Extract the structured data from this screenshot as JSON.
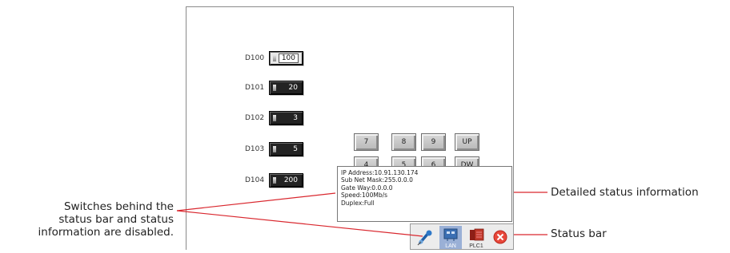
{
  "registers": [
    {
      "label": "D100",
      "value": "100",
      "focused": true
    },
    {
      "label": "D101",
      "value": "20",
      "focused": false
    },
    {
      "label": "D102",
      "value": "3",
      "focused": false
    },
    {
      "label": "D103",
      "value": "5",
      "focused": false
    },
    {
      "label": "D104",
      "value": "200",
      "focused": false
    }
  ],
  "keypad": {
    "row1": [
      "7",
      "8",
      "9",
      "UP"
    ],
    "row2": [
      "4",
      "5",
      "6",
      "DW"
    ]
  },
  "status_info": {
    "lines": [
      "IP Address:10.91.130.174",
      "Sub Net Mask:255.0.0.0",
      "Gate Way:0.0.0.0",
      "Speed:100Mb/s",
      "Duplex:Full"
    ]
  },
  "status_bar": {
    "items": [
      {
        "icon": "pin-icon",
        "caption": ""
      },
      {
        "icon": "lan-icon",
        "caption": "LAN"
      },
      {
        "icon": "plc-icon",
        "caption": "PLC1"
      },
      {
        "icon": "close-icon",
        "caption": ""
      }
    ],
    "colors": {
      "close": "#e8473a",
      "lan_selected": "#9ab0d6",
      "plc": "#c0392b"
    }
  },
  "annotations": {
    "left": [
      "Switches behind the",
      "status bar and status",
      "information are disabled."
    ],
    "detailed": "Detailed status information",
    "status_bar": "Status bar",
    "line_color": "#d9272e"
  }
}
